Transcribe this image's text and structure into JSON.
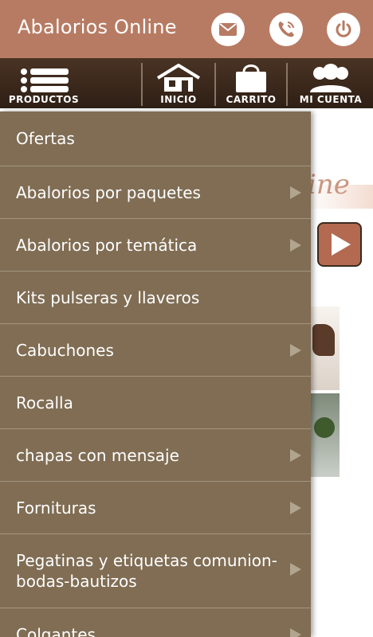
{
  "header": {
    "title": "Abalorios Online",
    "icons": [
      "mail-icon",
      "phone-icon",
      "power-icon"
    ],
    "color": "#b77b63"
  },
  "nav": {
    "items": [
      {
        "label": "PRODUCTOS",
        "icon": "menu-icon"
      },
      {
        "label": "INICIO",
        "icon": "home-icon"
      },
      {
        "label": "CARRITO",
        "icon": "bag-icon"
      },
      {
        "label": "MI CUENTA",
        "icon": "users-icon"
      }
    ]
  },
  "background": {
    "banner_text": "ine"
  },
  "drawer": {
    "color": "#806d54",
    "items": [
      {
        "label": "Ofertas",
        "submenu": false
      },
      {
        "label": "Abalorios por paquetes",
        "submenu": true
      },
      {
        "label": "Abalorios por temática",
        "submenu": true
      },
      {
        "label": "Kits pulseras y llaveros",
        "submenu": false
      },
      {
        "label": "Cabuchones",
        "submenu": true
      },
      {
        "label": "Rocalla",
        "submenu": false
      },
      {
        "label": "chapas con mensaje",
        "submenu": true
      },
      {
        "label": "Fornituras",
        "submenu": true
      },
      {
        "label": "Pegatinas y etiquetas comunion-bodas-bautizos",
        "submenu": true
      },
      {
        "label": "Colgantes",
        "submenu": true
      }
    ]
  }
}
